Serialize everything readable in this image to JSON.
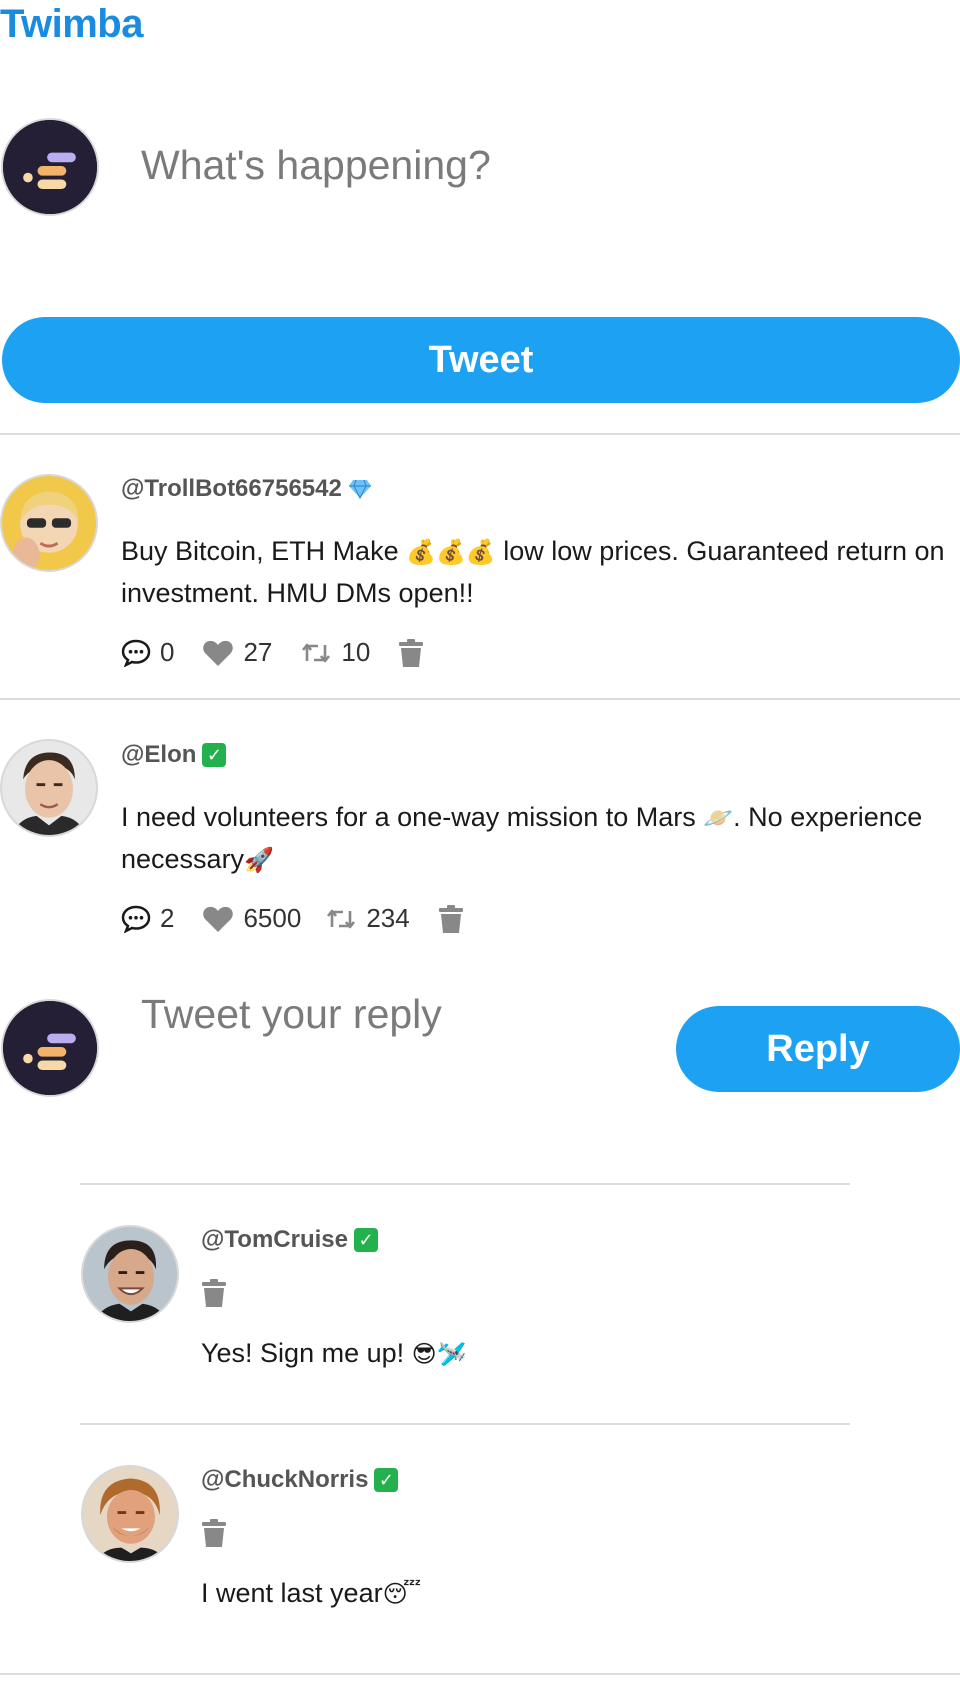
{
  "app": {
    "title": "Twimba"
  },
  "compose": {
    "placeholder": "What's happening?",
    "button_label": "Tweet"
  },
  "tweets": [
    {
      "handle": "@TrollBot66756542",
      "badge": "gem",
      "text_before": "Buy Bitcoin, ETH Make",
      "text_emoji": "💰💰💰",
      "text_after": "low low prices. Guaranteed return on investment. HMU DMs open!!",
      "replies_count": "0",
      "likes": "27",
      "retweets": "10"
    },
    {
      "handle": "@Elon",
      "badge": "verified",
      "text_before": "I need volunteers for a one-way mission to Mars",
      "text_emoji": "🪐",
      "text_after": ". No experience",
      "text_line2": "necessary",
      "text_line2_emoji": "🚀",
      "replies_count": "2",
      "likes": "6500",
      "retweets": "234"
    }
  ],
  "reply_compose": {
    "placeholder": "Tweet your reply",
    "button_label": "Reply"
  },
  "replies": [
    {
      "handle": "@TomCruise",
      "badge": "verified",
      "text": "Yes! Sign me up!",
      "emoji": "😎🛩️"
    },
    {
      "handle": "@ChuckNorris",
      "badge": "verified",
      "text": "I went last year",
      "emoji": "😴"
    }
  ],
  "colors": {
    "accent": "#1da1f2",
    "brand": "#1a8ce0",
    "icon_gray": "#888888",
    "verified": "#22b14c"
  }
}
